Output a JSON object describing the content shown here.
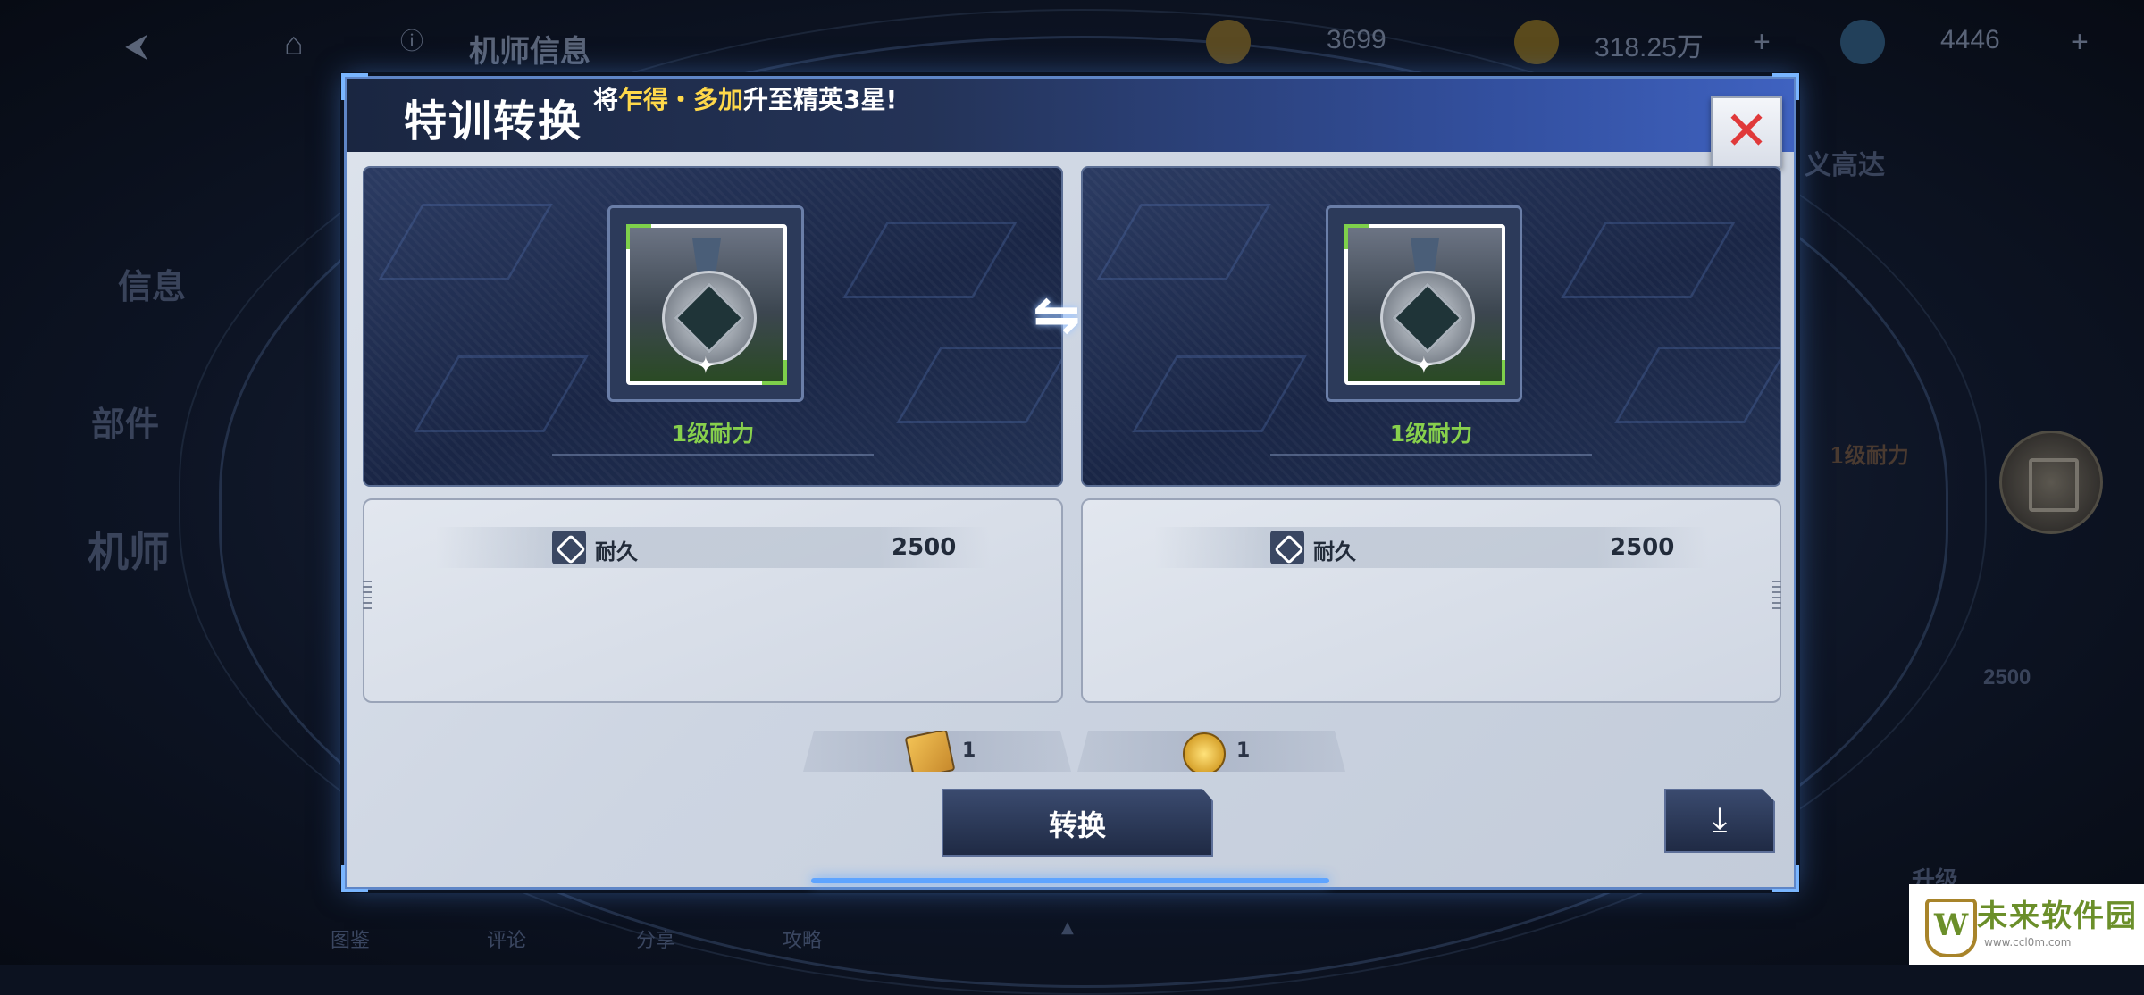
{
  "background": {
    "topbar": {
      "page_title": "机师信息",
      "currency_1": "3699",
      "currency_2": "318.25万",
      "currency_3": "4446"
    },
    "side_tabs": [
      "信息",
      "部件",
      "机师"
    ],
    "right_partial": {
      "label_1": "义高达",
      "label_2": "1级耐力",
      "value": "2500",
      "button": "升级"
    },
    "bottom_nav": [
      "图鉴",
      "评论",
      "分享",
      "攻略"
    ]
  },
  "modal": {
    "title": "特训转换",
    "subtitle_prefix": "将",
    "subtitle_highlight": "乍得・多加",
    "subtitle_suffix": "升至精英3星!",
    "close_icon": "close-icon",
    "left_card": {
      "level_label": "1级耐力",
      "stat_name": "耐久",
      "stat_value": "2500"
    },
    "right_card": {
      "level_label": "1级耐力",
      "stat_name": "耐久",
      "stat_value": "2500"
    },
    "swap_icon": "swap-arrows-icon",
    "costs": [
      {
        "icon": "training-card-icon",
        "amount": "1"
      },
      {
        "icon": "gold-coin-icon",
        "amount": "1"
      }
    ],
    "convert_button": "转换",
    "download_icon": "download-icon"
  },
  "watermark": {
    "text": "未来软件园",
    "sub": "www.ccl0m.com"
  }
}
